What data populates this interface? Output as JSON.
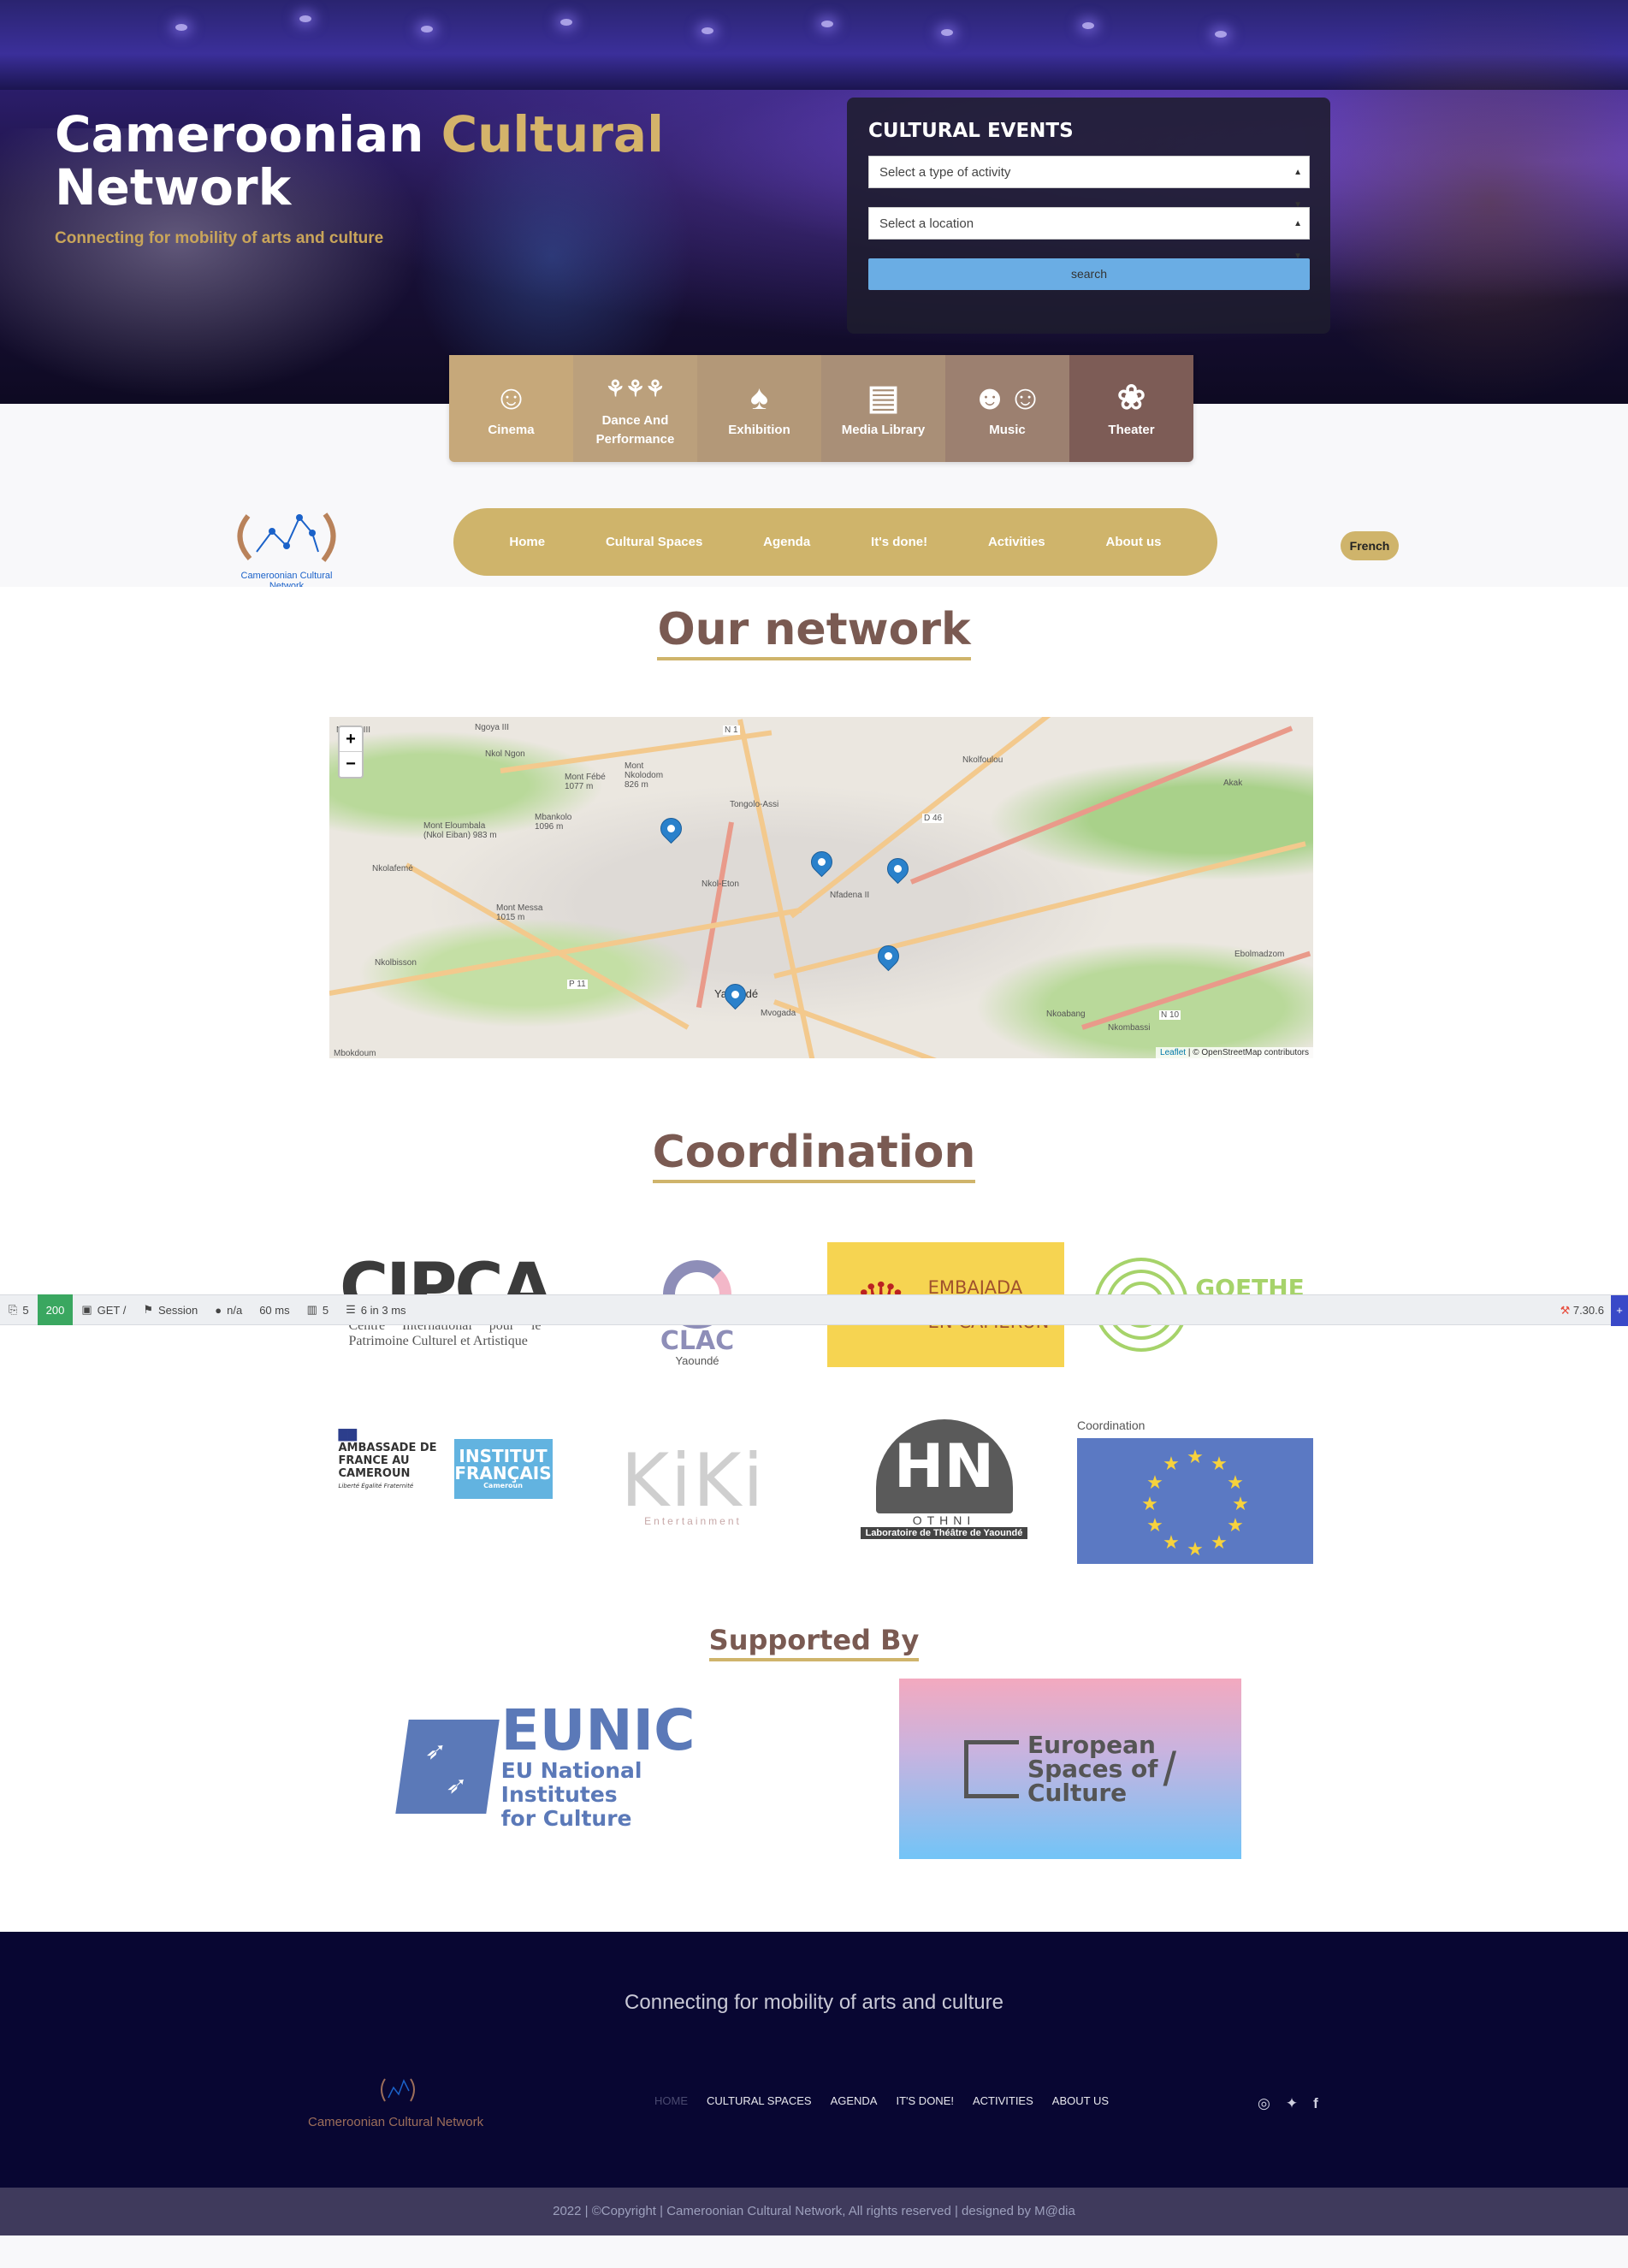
{
  "hero": {
    "title_part1": "Cameroonian ",
    "title_accent": "Cultural",
    "title_part2": "Network",
    "subtitle": "Connecting for mobility of arts and culture"
  },
  "events": {
    "heading": "CULTURAL EVENTS",
    "activity_select": "Select a type of activity",
    "location_select": "Select a location",
    "search_label": "search"
  },
  "categories": [
    {
      "label": "Cinema",
      "icon": "cinema-mask-icon"
    },
    {
      "label": "Dance And Performance",
      "icon": "dance-icon"
    },
    {
      "label": "Exhibition",
      "icon": "exhibition-mask-icon"
    },
    {
      "label": "Media Library",
      "icon": "book-icon"
    },
    {
      "label": "Music",
      "icon": "music-masks-icon"
    },
    {
      "label": "Theater",
      "icon": "theater-mask-icon"
    }
  ],
  "nav": {
    "logo_caption": "Cameroonian Cultural Network",
    "items": [
      "Home",
      "Cultural Spaces",
      "Agenda",
      "It's done!",
      "Activities",
      "About us"
    ],
    "language": "French"
  },
  "network": {
    "title": "Our network",
    "map": {
      "zoom_in": "+",
      "zoom_out": "−",
      "places": [
        "Ngoya III",
        "Nkol Ngon",
        "Mont Fébé 1077 m",
        "Mont Nkolodom 826 m",
        "Mbankolo 1096 m",
        "Mont Eloumbala (Nkol Eiban) 983 m",
        "Nkolafemé",
        "Tongolo-Assi",
        "Nkol-Eton",
        "Nfadena II",
        "Mont Messa 1015 m",
        "Nkolbisson",
        "Yaoundé",
        "Mvogada",
        "Nkolfoulou",
        "Akak",
        "Ebolmadzom",
        "Nkoabang",
        "Nkombassi",
        "Mbokdoum"
      ],
      "road_labels": [
        "N 1",
        "D 46",
        "P 11",
        "N 10"
      ],
      "attribution_leaflet": "Leaflet",
      "attribution_rest": " | © OpenStreetMap contributors"
    }
  },
  "coordination": {
    "title": "Coordination",
    "logos": {
      "cipca_word": "CIPCA",
      "cipca_text": "Centre International pour le Patrimoine Culturel et Artistique",
      "clac_word": "CLAC",
      "clac_city": "Yaoundé",
      "spain_line1": "EMBAJADA",
      "spain_line2": "EN CAMERÚN",
      "goethe_word": "GOETHE",
      "france_text": "AMBASSADE DE FRANCE AU CAMEROUN",
      "france_motto": "Liberté Égalité Fraternité",
      "ifr_line1": "INSTITUT",
      "ifr_line2": "FRANÇAIS",
      "ifr_line3": "Cameroun",
      "kiki_word": "KiKi",
      "kiki_sub": "Entertainment",
      "othni_word": "OTHNI",
      "othni_sub": "Laboratoire de Théâtre de Yaoundé",
      "eu_caption": "Coordination"
    }
  },
  "debug_bar": {
    "routes": "5",
    "status": "200",
    "method": "GET /",
    "session": "Session",
    "user": "n/a",
    "time": "60 ms",
    "views": "5",
    "queries": "6 in 3 ms",
    "version": "7.30.6"
  },
  "supported": {
    "title": "Supported By",
    "eunic_word": "EUNIC",
    "eunic_line1": "EU National Institutes",
    "eunic_line2": "for Culture",
    "esc_line1": "European",
    "esc_line2": "Spaces of",
    "esc_line3": "Culture"
  },
  "footer": {
    "tagline": "Connecting for mobility of arts and culture",
    "logo_caption": "Cameroonian Cultural Network",
    "nav": [
      "HOME",
      "CULTURAL SPACES",
      "AGENDA",
      "IT'S DONE!",
      "ACTIVITIES",
      "ABOUT US"
    ],
    "social": [
      "instagram-icon",
      "twitter-icon",
      "facebook-icon"
    ],
    "copyright": "2022 | ©Copyright | Cameroonian Cultural Network, All rights reserved | designed by M@dia"
  },
  "colors": {
    "gold": "#cfb46b",
    "brown": "#7a5a52",
    "footer_bg": "#080632",
    "search_blue": "#6aade4"
  }
}
